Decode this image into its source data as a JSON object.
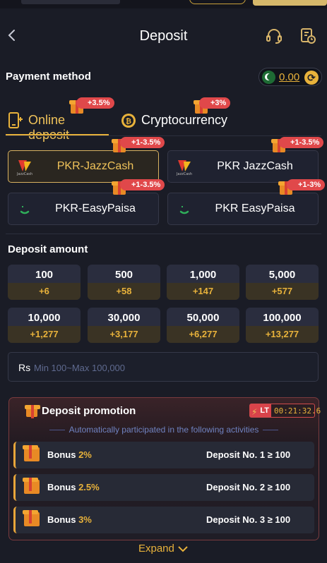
{
  "header": {
    "title": "Deposit",
    "back_icon": "chevron-left-icon",
    "support_icon": "headset-icon",
    "history_icon": "history-document-icon"
  },
  "payment": {
    "label": "Payment method",
    "balance": "0.00",
    "tabs": [
      {
        "label": "Online deposit",
        "promo": "+3.5%",
        "active": true
      },
      {
        "label": "Cryptocurrency",
        "promo": "+3%",
        "active": false
      }
    ],
    "methods": [
      {
        "name": "PKR-JazzCash",
        "promo": "+1-3.5%",
        "selected": true
      },
      {
        "name": "PKR JazzCash",
        "promo": "+1-3.5%",
        "selected": false
      },
      {
        "name": "PKR-EasyPaisa",
        "promo": "+1-3.5%",
        "selected": false
      },
      {
        "name": "PKR EasyPaisa",
        "promo": "+1-3%",
        "selected": false
      }
    ]
  },
  "amount": {
    "label": "Deposit amount",
    "chips": [
      {
        "value": "100",
        "bonus": "+6"
      },
      {
        "value": "500",
        "bonus": "+58"
      },
      {
        "value": "1,000",
        "bonus": "+147"
      },
      {
        "value": "5,000",
        "bonus": "+577"
      },
      {
        "value": "10,000",
        "bonus": "+1,277"
      },
      {
        "value": "30,000",
        "bonus": "+3,177"
      },
      {
        "value": "50,000",
        "bonus": "+6,277"
      },
      {
        "value": "100,000",
        "bonus": "+13,277"
      }
    ],
    "currency": "Rs",
    "placeholder": "Min 100~Max 100,000"
  },
  "promotion": {
    "title": "Deposit promotion",
    "lt_label": "LT",
    "timer": "00:21:32.6",
    "note": "Automatically participated in the following activities",
    "bonuses": [
      {
        "label": "Bonus",
        "percent": "2%",
        "condition": "Deposit No. 1 ≥ 100"
      },
      {
        "label": "Bonus",
        "percent": "2.5%",
        "condition": "Deposit No. 2 ≥ 100"
      },
      {
        "label": "Bonus",
        "percent": "3%",
        "condition": "Deposit No. 3 ≥ 100"
      }
    ],
    "expand_label": "Expand"
  },
  "colors": {
    "background": "#1a1c26",
    "accent_gold": "#e8b23b",
    "promo_red": "#e0484a"
  }
}
